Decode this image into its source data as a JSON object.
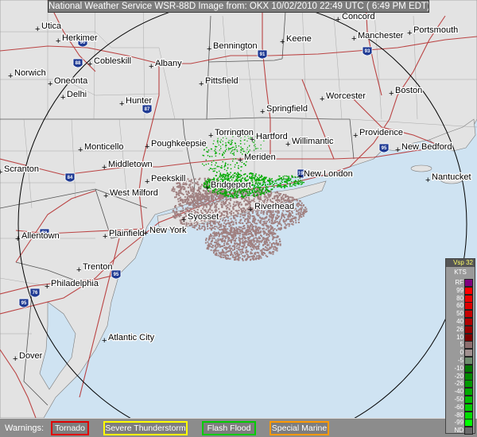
{
  "header": {
    "title": "National Weather Service WSR-88D Image from: OKX 10/02/2010 22:49 UTC ( 6:49 PM EDT)"
  },
  "cities": [
    {
      "name": "Concord"
    },
    {
      "name": "Utica"
    },
    {
      "name": "Herkimer"
    },
    {
      "name": "Bennington"
    },
    {
      "name": "Keene"
    },
    {
      "name": "Manchester"
    },
    {
      "name": "Portsmouth"
    },
    {
      "name": "Norwich"
    },
    {
      "name": "Cobleskill"
    },
    {
      "name": "Albany"
    },
    {
      "name": "Oneonta"
    },
    {
      "name": "Pittsfield"
    },
    {
      "name": "Delhi"
    },
    {
      "name": "Hunter"
    },
    {
      "name": "Springfield"
    },
    {
      "name": "Worcester"
    },
    {
      "name": "Boston"
    },
    {
      "name": "Torrington"
    },
    {
      "name": "Hartford"
    },
    {
      "name": "Willimantic"
    },
    {
      "name": "Providence"
    },
    {
      "name": "Monticello"
    },
    {
      "name": "Poughkeepsie"
    },
    {
      "name": "New Bedford"
    },
    {
      "name": "Meriden"
    },
    {
      "name": "Middletown"
    },
    {
      "name": "Scranton"
    },
    {
      "name": "Peekskill"
    },
    {
      "name": "New London"
    },
    {
      "name": "Nantucket"
    },
    {
      "name": "Bridgeport"
    },
    {
      "name": "West Milford"
    },
    {
      "name": "Riverhead"
    },
    {
      "name": "Syosset"
    },
    {
      "name": "Allentown"
    },
    {
      "name": "Plainfield"
    },
    {
      "name": "New York"
    },
    {
      "name": "Trenton"
    },
    {
      "name": "Philadelphia"
    },
    {
      "name": "Atlantic City"
    },
    {
      "name": "Dover"
    }
  ],
  "highways": [
    {
      "label": "90"
    },
    {
      "label": "88"
    },
    {
      "label": "91"
    },
    {
      "label": "93"
    },
    {
      "label": "87"
    },
    {
      "label": "95"
    },
    {
      "label": "84"
    },
    {
      "label": "78"
    },
    {
      "label": "195"
    },
    {
      "label": "76"
    },
    {
      "label": "95"
    },
    {
      "label": "95"
    }
  ],
  "warnings": {
    "label": "Warnings:",
    "items": [
      {
        "label": "Tornado",
        "color": "#e00000"
      },
      {
        "label": "Severe Thunderstorm",
        "color": "#ffff00"
      },
      {
        "label": "Flash Flood",
        "color": "#00cc00"
      },
      {
        "label": "Special Marine",
        "color": "#ff9900"
      }
    ]
  },
  "legend": {
    "product": "Vsp 32",
    "units": "KTS",
    "entries": [
      {
        "label": "RF",
        "color": "#800080"
      },
      {
        "label": "99",
        "color": "#ff0000"
      },
      {
        "label": "80",
        "color": "#ee0000"
      },
      {
        "label": "60",
        "color": "#dd0000"
      },
      {
        "label": "50",
        "color": "#c80000"
      },
      {
        "label": "40",
        "color": "#b00000"
      },
      {
        "label": "26",
        "color": "#960000"
      },
      {
        "label": "10",
        "color": "#7a0000"
      },
      {
        "label": "5",
        "color": "#8c6e6e"
      },
      {
        "label": "0",
        "color": "#a09090"
      },
      {
        "label": "-5",
        "color": "#6e8c6e"
      },
      {
        "label": "-10",
        "color": "#007700"
      },
      {
        "label": "-20",
        "color": "#008800"
      },
      {
        "label": "-26",
        "color": "#009900"
      },
      {
        "label": "-40",
        "color": "#00aa00"
      },
      {
        "label": "-50",
        "color": "#00bb00"
      },
      {
        "label": "-60",
        "color": "#00cc00"
      },
      {
        "label": "-80",
        "color": "#00dd00"
      },
      {
        "label": "-99",
        "color": "#00ff00"
      },
      {
        "label": "ND",
        "color": "#6a6a6a"
      }
    ]
  },
  "colors": {
    "water": "#cfe3f2",
    "range_ring": "#000000",
    "echo_rain": "#a08080",
    "echo_green": "#00aa00"
  }
}
